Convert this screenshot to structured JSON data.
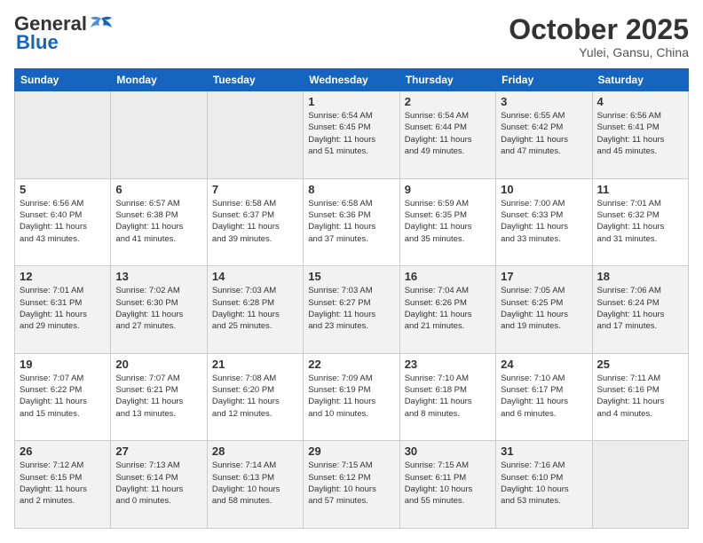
{
  "header": {
    "logo_line1": "General",
    "logo_line2": "Blue",
    "month_title": "October 2025",
    "location": "Yulei, Gansu, China"
  },
  "weekdays": [
    "Sunday",
    "Monday",
    "Tuesday",
    "Wednesday",
    "Thursday",
    "Friday",
    "Saturday"
  ],
  "weeks": [
    [
      {
        "day": "",
        "text": ""
      },
      {
        "day": "",
        "text": ""
      },
      {
        "day": "",
        "text": ""
      },
      {
        "day": "1",
        "text": "Sunrise: 6:54 AM\nSunset: 6:45 PM\nDaylight: 11 hours\nand 51 minutes."
      },
      {
        "day": "2",
        "text": "Sunrise: 6:54 AM\nSunset: 6:44 PM\nDaylight: 11 hours\nand 49 minutes."
      },
      {
        "day": "3",
        "text": "Sunrise: 6:55 AM\nSunset: 6:42 PM\nDaylight: 11 hours\nand 47 minutes."
      },
      {
        "day": "4",
        "text": "Sunrise: 6:56 AM\nSunset: 6:41 PM\nDaylight: 11 hours\nand 45 minutes."
      }
    ],
    [
      {
        "day": "5",
        "text": "Sunrise: 6:56 AM\nSunset: 6:40 PM\nDaylight: 11 hours\nand 43 minutes."
      },
      {
        "day": "6",
        "text": "Sunrise: 6:57 AM\nSunset: 6:38 PM\nDaylight: 11 hours\nand 41 minutes."
      },
      {
        "day": "7",
        "text": "Sunrise: 6:58 AM\nSunset: 6:37 PM\nDaylight: 11 hours\nand 39 minutes."
      },
      {
        "day": "8",
        "text": "Sunrise: 6:58 AM\nSunset: 6:36 PM\nDaylight: 11 hours\nand 37 minutes."
      },
      {
        "day": "9",
        "text": "Sunrise: 6:59 AM\nSunset: 6:35 PM\nDaylight: 11 hours\nand 35 minutes."
      },
      {
        "day": "10",
        "text": "Sunrise: 7:00 AM\nSunset: 6:33 PM\nDaylight: 11 hours\nand 33 minutes."
      },
      {
        "day": "11",
        "text": "Sunrise: 7:01 AM\nSunset: 6:32 PM\nDaylight: 11 hours\nand 31 minutes."
      }
    ],
    [
      {
        "day": "12",
        "text": "Sunrise: 7:01 AM\nSunset: 6:31 PM\nDaylight: 11 hours\nand 29 minutes."
      },
      {
        "day": "13",
        "text": "Sunrise: 7:02 AM\nSunset: 6:30 PM\nDaylight: 11 hours\nand 27 minutes."
      },
      {
        "day": "14",
        "text": "Sunrise: 7:03 AM\nSunset: 6:28 PM\nDaylight: 11 hours\nand 25 minutes."
      },
      {
        "day": "15",
        "text": "Sunrise: 7:03 AM\nSunset: 6:27 PM\nDaylight: 11 hours\nand 23 minutes."
      },
      {
        "day": "16",
        "text": "Sunrise: 7:04 AM\nSunset: 6:26 PM\nDaylight: 11 hours\nand 21 minutes."
      },
      {
        "day": "17",
        "text": "Sunrise: 7:05 AM\nSunset: 6:25 PM\nDaylight: 11 hours\nand 19 minutes."
      },
      {
        "day": "18",
        "text": "Sunrise: 7:06 AM\nSunset: 6:24 PM\nDaylight: 11 hours\nand 17 minutes."
      }
    ],
    [
      {
        "day": "19",
        "text": "Sunrise: 7:07 AM\nSunset: 6:22 PM\nDaylight: 11 hours\nand 15 minutes."
      },
      {
        "day": "20",
        "text": "Sunrise: 7:07 AM\nSunset: 6:21 PM\nDaylight: 11 hours\nand 13 minutes."
      },
      {
        "day": "21",
        "text": "Sunrise: 7:08 AM\nSunset: 6:20 PM\nDaylight: 11 hours\nand 12 minutes."
      },
      {
        "day": "22",
        "text": "Sunrise: 7:09 AM\nSunset: 6:19 PM\nDaylight: 11 hours\nand 10 minutes."
      },
      {
        "day": "23",
        "text": "Sunrise: 7:10 AM\nSunset: 6:18 PM\nDaylight: 11 hours\nand 8 minutes."
      },
      {
        "day": "24",
        "text": "Sunrise: 7:10 AM\nSunset: 6:17 PM\nDaylight: 11 hours\nand 6 minutes."
      },
      {
        "day": "25",
        "text": "Sunrise: 7:11 AM\nSunset: 6:16 PM\nDaylight: 11 hours\nand 4 minutes."
      }
    ],
    [
      {
        "day": "26",
        "text": "Sunrise: 7:12 AM\nSunset: 6:15 PM\nDaylight: 11 hours\nand 2 minutes."
      },
      {
        "day": "27",
        "text": "Sunrise: 7:13 AM\nSunset: 6:14 PM\nDaylight: 11 hours\nand 0 minutes."
      },
      {
        "day": "28",
        "text": "Sunrise: 7:14 AM\nSunset: 6:13 PM\nDaylight: 10 hours\nand 58 minutes."
      },
      {
        "day": "29",
        "text": "Sunrise: 7:15 AM\nSunset: 6:12 PM\nDaylight: 10 hours\nand 57 minutes."
      },
      {
        "day": "30",
        "text": "Sunrise: 7:15 AM\nSunset: 6:11 PM\nDaylight: 10 hours\nand 55 minutes."
      },
      {
        "day": "31",
        "text": "Sunrise: 7:16 AM\nSunset: 6:10 PM\nDaylight: 10 hours\nand 53 minutes."
      },
      {
        "day": "",
        "text": ""
      }
    ]
  ]
}
